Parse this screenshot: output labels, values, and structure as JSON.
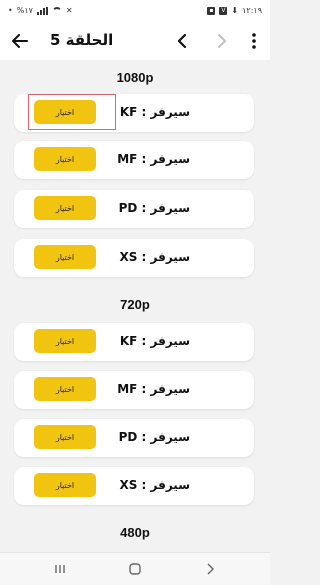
{
  "status_bar": {
    "time": "١٢:١٩",
    "battery": "%١٧"
  },
  "app_bar": {
    "title": "الحلقة 5"
  },
  "sections": [
    {
      "title": "1080p",
      "servers": [
        {
          "label": "سيرفر : KF",
          "button": "اختيار"
        },
        {
          "label": "سيرفر : MF",
          "button": "اختيار"
        },
        {
          "label": "سيرفر : PD",
          "button": "اختيار"
        },
        {
          "label": "سيرفر : XS",
          "button": "اختيار"
        }
      ]
    },
    {
      "title": "720p",
      "servers": [
        {
          "label": "سيرفر : KF",
          "button": "اختيار"
        },
        {
          "label": "سيرفر : MF",
          "button": "اختيار"
        },
        {
          "label": "سيرفر : PD",
          "button": "اختيار"
        },
        {
          "label": "سيرفر : XS",
          "button": "اختيار"
        }
      ]
    },
    {
      "title": "480p",
      "servers": []
    }
  ],
  "colors": {
    "accent": "#f1c40f",
    "background": "#f2f2f2",
    "card": "#ffffff",
    "highlight": "#e06666"
  }
}
